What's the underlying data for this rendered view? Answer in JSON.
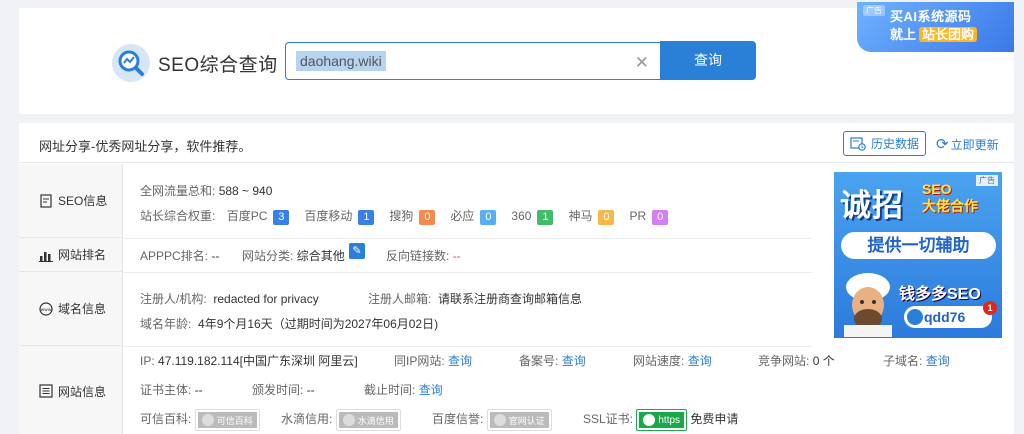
{
  "top": {
    "title": "SEO综合查询",
    "search_value": "daohang.wiki",
    "search_button": "查询",
    "ad": {
      "tag": "广告",
      "line1": "买AI系统源码",
      "line2_prefix": "就上",
      "line2_highlight": "站长团购"
    }
  },
  "header": {
    "description": "网址分享-优秀网址分享，软件推荐。",
    "history_button": "历史数据",
    "update_button": "立即更新"
  },
  "seo": {
    "section_label": "SEO信息",
    "traffic_label": "全网流量总和:",
    "traffic_value": "588 ~ 940",
    "weight_label": "站长综合权重:",
    "weights": [
      {
        "name": "百度PC",
        "value": "3",
        "color": "#3a7ee8"
      },
      {
        "name": "百度移动",
        "value": "1",
        "color": "#3a7ee8"
      },
      {
        "name": "搜狗",
        "value": "0",
        "color": "#f48b4e"
      },
      {
        "name": "必应",
        "value": "0",
        "color": "#57aef0"
      },
      {
        "name": "360",
        "value": "1",
        "color": "#41bd6a"
      },
      {
        "name": "神马",
        "value": "0",
        "color": "#f7b84b"
      },
      {
        "name": "PR",
        "value": "0",
        "color": "#d47ef5"
      }
    ]
  },
  "ranking": {
    "section_label": "网站排名",
    "apppc_label": "APPPC排名:",
    "apppc_value": "--",
    "category_label": "网站分类:",
    "category_value": "综合其他",
    "backlinks_label": "反向链接数:",
    "backlinks_value": "--"
  },
  "domain": {
    "section_label": "域名信息",
    "registrant_label": "注册人/机构:",
    "registrant_value": "redacted for privacy",
    "email_label": "注册人邮箱:",
    "email_value": "请联系注册商查询邮箱信息",
    "age_label": "域名年龄:",
    "age_value": "4年9个月16天（过期时间为2027年06月02日)"
  },
  "site": {
    "section_label": "网站信息",
    "ip_label": "IP:",
    "ip_value": "47.119.182.114[中国广东深圳 阿里云]",
    "sameip_label": "同IP网站:",
    "sameip_value": "查询",
    "beian_label": "备案号:",
    "beian_value": "查询",
    "speed_label": "网站速度:",
    "speed_value": "查询",
    "competitor_label": "竞争网站:",
    "competitor_value": "0 个",
    "subdomain_label": "子域名:",
    "subdomain_value": "查询",
    "cert_subject_label": "证书主体:",
    "cert_subject_value": "--",
    "issue_label": "颁发时间:",
    "issue_value": "--",
    "expire_label": "截止时间:",
    "expire_value": "查询",
    "baike_label": "可信百科:",
    "baike_badge": "可信百科",
    "shuidi_label": "水滴信用:",
    "shuidi_badge": "水滴信用",
    "baidu_label": "百度信誉:",
    "baidu_badge": "官网认证",
    "ssl_label": "SSL证书:",
    "ssl_badge": "https",
    "ssl_free": "免费申请"
  },
  "side_ad": {
    "tag": "广告",
    "big": "诚招",
    "small1": "SEO",
    "small2": "大佬合作",
    "pill": "提供一切辅助",
    "money": "钱多多SEO",
    "contact": "qdd76",
    "badge_num": "1"
  }
}
